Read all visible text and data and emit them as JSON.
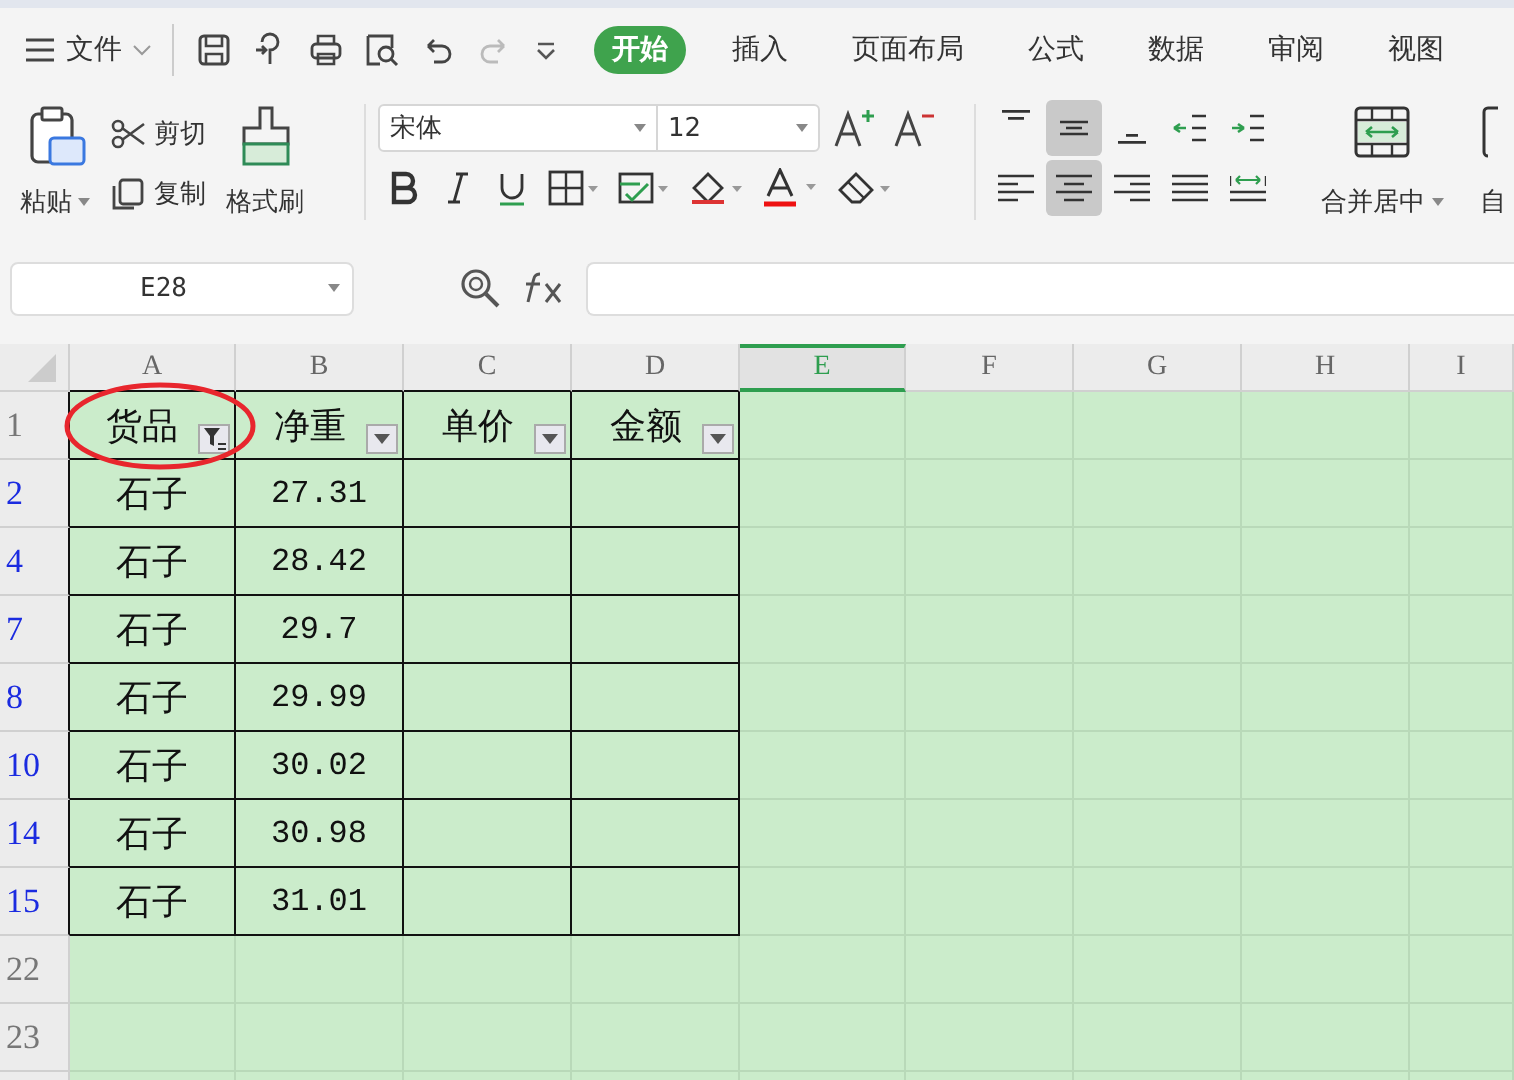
{
  "menu": {
    "label": "文件"
  },
  "tabs": [
    {
      "label": "开始",
      "selected": true
    },
    {
      "label": "插入",
      "selected": false
    },
    {
      "label": "页面布局",
      "selected": false
    },
    {
      "label": "公式",
      "selected": false
    },
    {
      "label": "数据",
      "selected": false
    },
    {
      "label": "审阅",
      "selected": false
    },
    {
      "label": "视图",
      "selected": false
    }
  ],
  "clipboard": {
    "paste": "粘贴",
    "cut": "剪切",
    "copy": "复制",
    "format_painter": "格式刷"
  },
  "font": {
    "name": "宋体",
    "size": "12"
  },
  "alignment": [
    {
      "kind": "top",
      "selected": false
    },
    {
      "kind": "middle",
      "selected": true
    },
    {
      "kind": "bottom",
      "selected": false
    },
    {
      "kind": "outdent",
      "selected": false
    },
    {
      "kind": "indent",
      "selected": false
    },
    {
      "kind": "left",
      "selected": false
    },
    {
      "kind": "center",
      "selected": true
    },
    {
      "kind": "right",
      "selected": false
    },
    {
      "kind": "justify",
      "selected": false
    },
    {
      "kind": "distributed",
      "selected": false
    }
  ],
  "merge": {
    "label": "合并居中"
  },
  "wrap": {
    "label": "自"
  },
  "name_box": {
    "value": "E28"
  },
  "sheet": {
    "columns": [
      {
        "label": "A",
        "selected": false
      },
      {
        "label": "B",
        "selected": false
      },
      {
        "label": "C",
        "selected": false
      },
      {
        "label": "D",
        "selected": false
      },
      {
        "label": "E",
        "selected": true
      },
      {
        "label": "F",
        "selected": false
      },
      {
        "label": "G",
        "selected": false
      },
      {
        "label": "H",
        "selected": false
      },
      {
        "label": "I",
        "selected": false
      }
    ],
    "header_row": {
      "number": "1",
      "cells": [
        {
          "text": "货品",
          "filter_active": true
        },
        {
          "text": "净重",
          "filter_active": false
        },
        {
          "text": "单价",
          "filter_active": false
        },
        {
          "text": "金额",
          "filter_active": false
        }
      ]
    },
    "rows": [
      {
        "number": "2",
        "filtered": true,
        "product": "石子",
        "weight": "27.31"
      },
      {
        "number": "4",
        "filtered": true,
        "product": "石子",
        "weight": "28.42"
      },
      {
        "number": "7",
        "filtered": true,
        "product": "石子",
        "weight": "29.7"
      },
      {
        "number": "8",
        "filtered": true,
        "product": "石子",
        "weight": "29.99"
      },
      {
        "number": "10",
        "filtered": true,
        "product": "石子",
        "weight": "30.02"
      },
      {
        "number": "14",
        "filtered": true,
        "product": "石子",
        "weight": "30.98"
      },
      {
        "number": "15",
        "filtered": true,
        "product": "石子",
        "weight": "31.01"
      }
    ],
    "blank_rows": [
      {
        "number": "22"
      },
      {
        "number": "23"
      }
    ]
  }
}
